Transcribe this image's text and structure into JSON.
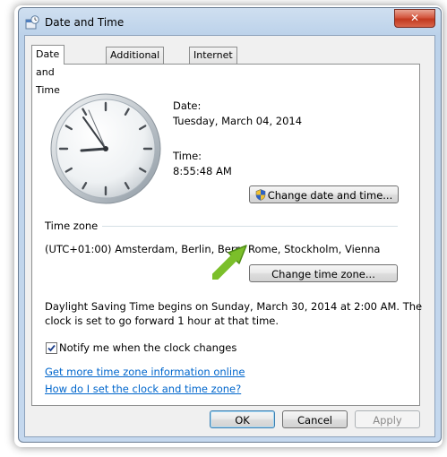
{
  "window": {
    "title": "Date and Time",
    "close_glyph": "✕"
  },
  "tabs": [
    {
      "label": "Date and Time",
      "active": true
    },
    {
      "label": "Additional Clocks",
      "active": false
    },
    {
      "label": "Internet Time",
      "active": false
    }
  ],
  "clock": {
    "time": "8:55:48 AM"
  },
  "date_section": {
    "date_label": "Date:",
    "date_value": "Tuesday, March 04, 2014",
    "time_label": "Time:",
    "time_value": "8:55:48 AM",
    "change_date_button": "Change date and time...",
    "shield_icon": "uac-shield-icon"
  },
  "timezone": {
    "heading": "Time zone",
    "value": "(UTC+01:00) Amsterdam, Berlin, Bern, Rome, Stockholm, Vienna",
    "change_button": "Change time zone..."
  },
  "dst": {
    "line1": "Daylight Saving Time begins on Sunday, March 30, 2014 at 2:00 AM. The",
    "line2": "clock is set to go forward 1 hour at that time."
  },
  "notify": {
    "label": "Notify me when the clock changes",
    "checked": true
  },
  "links": {
    "more_info": "Get more time zone information online",
    "how_to": "How do I set the clock and time zone?"
  },
  "footer": {
    "ok": "OK",
    "cancel": "Cancel",
    "apply": "Apply"
  },
  "colors": {
    "link": "#0066cc",
    "arrow": "#7bbf2a",
    "window_frame": "#bcd2ea"
  }
}
